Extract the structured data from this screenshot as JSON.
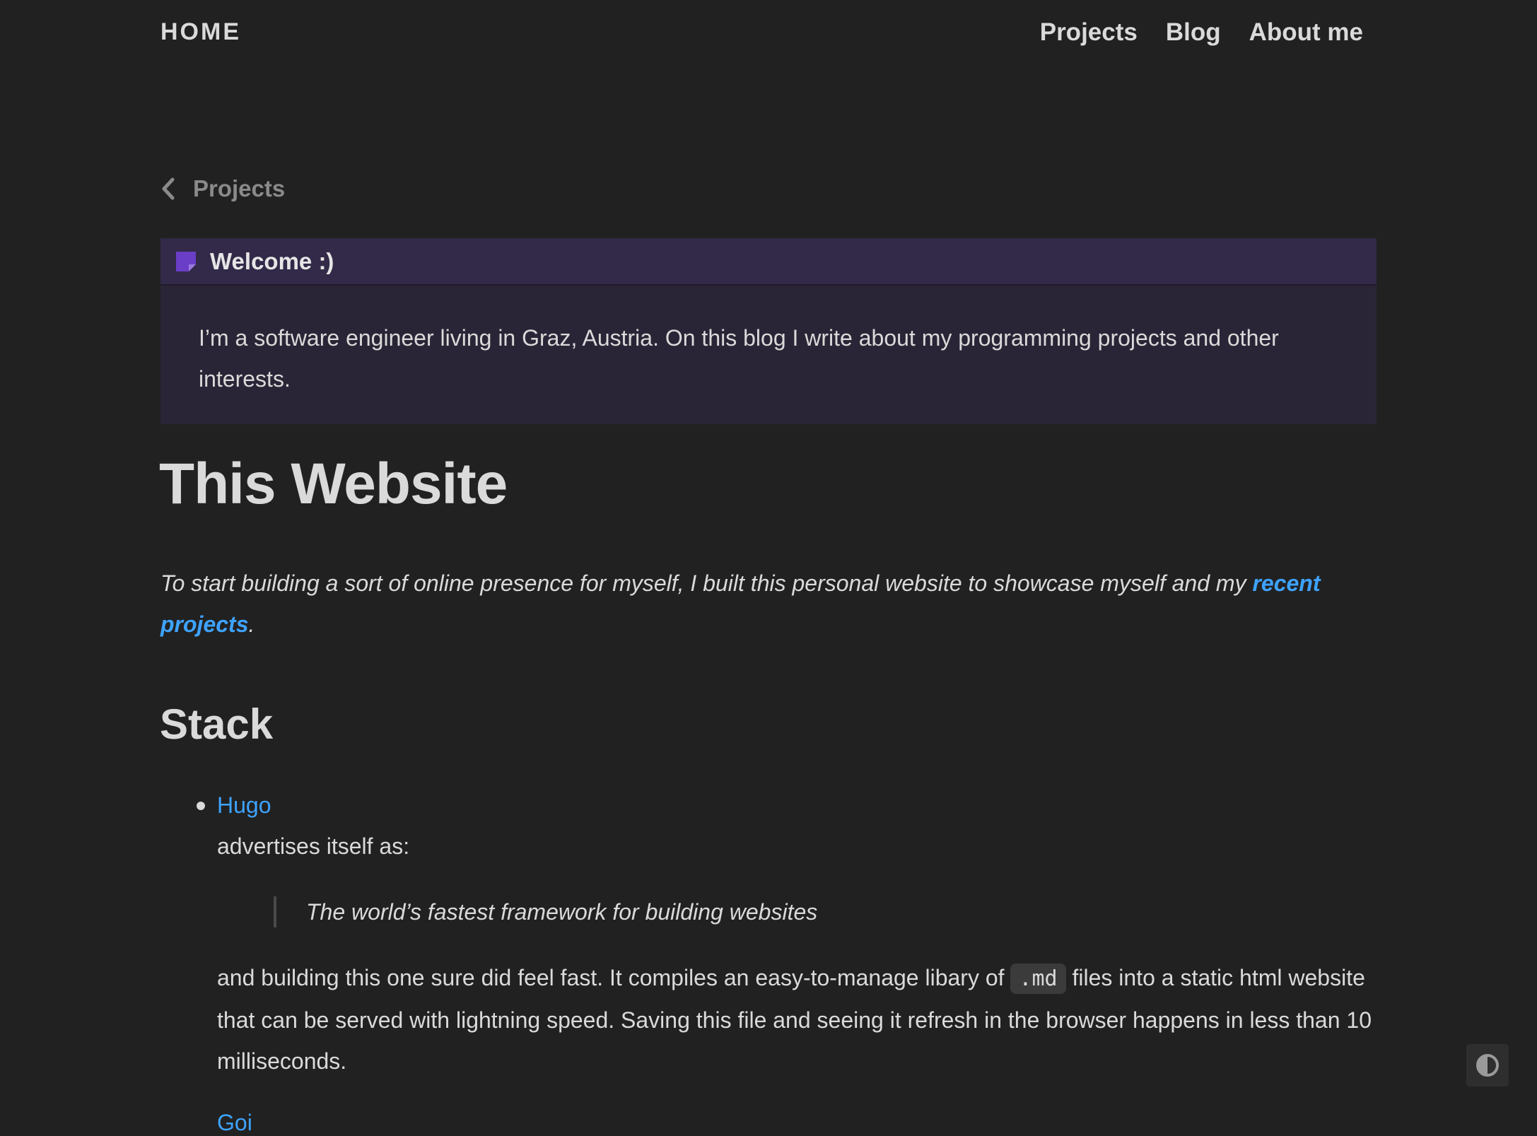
{
  "header": {
    "home_label": "HOME",
    "nav": [
      {
        "label": "Projects"
      },
      {
        "label": "Blog"
      },
      {
        "label": "About me"
      }
    ]
  },
  "back_link": {
    "label": "Projects",
    "icon": "chevron-left-icon"
  },
  "callout": {
    "icon": "note-icon",
    "title": "Welcome :)",
    "body": "I’m a software engineer living in Graz, Austria. On this blog I write about my programming projects and other interests."
  },
  "article": {
    "title": "This Website",
    "intro_text": "To start building a sort of online presence for myself, I built this personal website to showcase myself and my ",
    "intro_link": "re­cent projects",
    "intro_end": ".",
    "section_title": "Stack",
    "stack_items": [
      {
        "link": "Hugo",
        "advertises": "advertises itself as:",
        "quote": "The world’s fastest framework for building websites",
        "para_before": "and building this one sure did feel fast. It compiles an easy-to-manage libary of ",
        "code": ".md",
        "para_after": " files into a static html website that can be served with lightning speed. Saving this file and seeing it refresh in the browser happens in less than 10 milliseconds."
      }
    ],
    "next_item_partial": "Goi"
  },
  "colors": {
    "background": "#212121",
    "text": "#dadada",
    "link": "#3ea3ff",
    "callout_head": "#322a48",
    "callout_body": "#2a2536",
    "callout_icon": "#6a3ec6"
  },
  "theme_toggle": {
    "icon": "contrast-icon"
  }
}
